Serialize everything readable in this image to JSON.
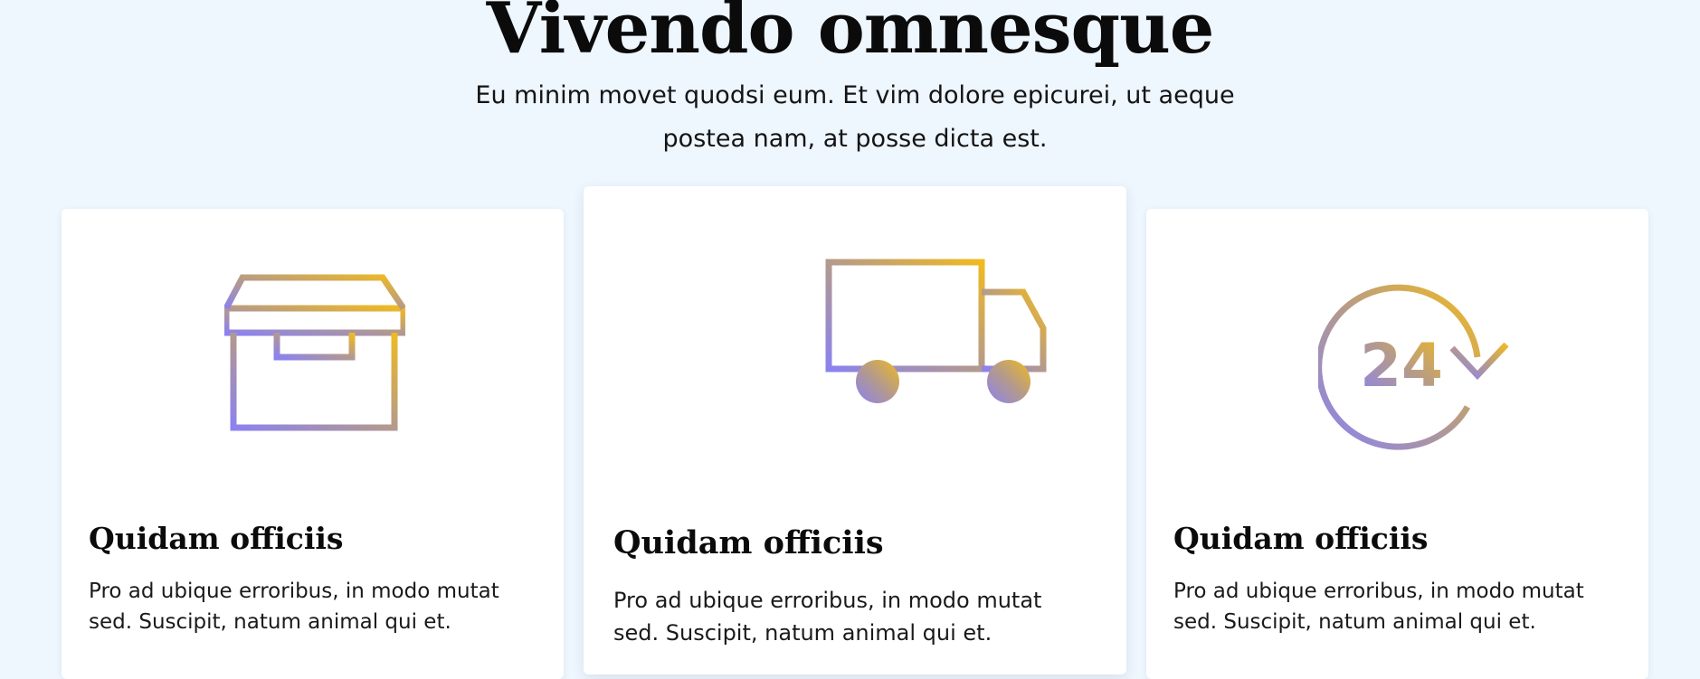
{
  "hero": {
    "title": "Vivendo omnesque",
    "subtitle": "Eu minim movet quodsi eum. Et vim dolore epicurei, ut aeque postea nam, at posse dicta est."
  },
  "colors": {
    "page_background": "#eef6fe",
    "card_background": "#ffffff",
    "icon_gradient_start": "#8b82f0",
    "icon_gradient_mid": "#b49a8c",
    "icon_gradient_end": "#f0ba21"
  },
  "features": [
    {
      "icon": "archive-box-icon",
      "title": "Quidam officiis",
      "text": "Pro ad ubique erroribus, in modo mutat sed. Suscipit, natum animal qui et."
    },
    {
      "icon": "delivery-truck-icon",
      "title": "Quidam officiis",
      "text": "Pro ad ubique erroribus, in modo mutat sed. Suscipit, natum animal qui et."
    },
    {
      "icon": "24-hours-icon",
      "title": "Quidam officiis",
      "text": "Pro ad ubique erroribus, in modo mutat sed. Suscipit, natum animal qui et.",
      "icon_label": "24"
    }
  ]
}
